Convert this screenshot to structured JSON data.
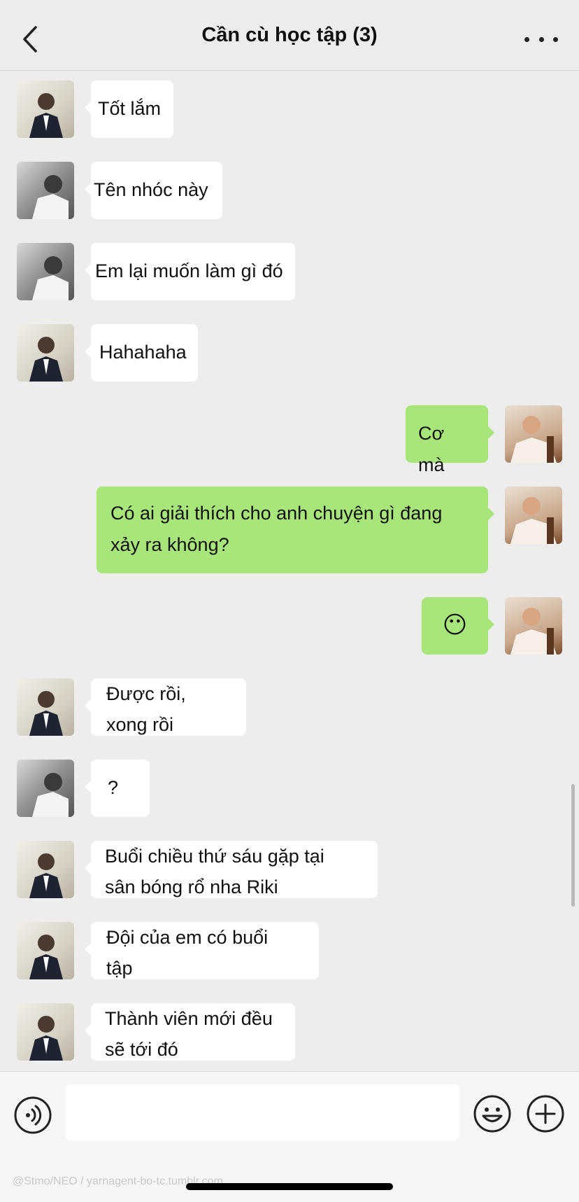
{
  "header": {
    "title": "Cần cù học tập (3)",
    "back_icon": "chevron-left-icon",
    "more_icon": "more-dots-icon"
  },
  "messages": [
    {
      "side": "in",
      "avatar": "suit",
      "text": "Tốt lắm"
    },
    {
      "side": "in",
      "avatar": "bw",
      "text": "Tên nhóc này"
    },
    {
      "side": "in",
      "avatar": "bw",
      "text": "Em lại muốn làm gì đó"
    },
    {
      "side": "in",
      "avatar": "suit",
      "text": "Hahahaha"
    },
    {
      "side": "out",
      "avatar": "pink",
      "text": "Cơ mà"
    },
    {
      "side": "out",
      "avatar": "pink",
      "text": "Có ai giải thích cho anh chuyện gì đang\nxảy ra không?"
    },
    {
      "side": "out",
      "avatar": "pink",
      "text": "😶"
    },
    {
      "side": "in",
      "avatar": "suit",
      "text": "Được rồi,\nxong rồi"
    },
    {
      "side": "in",
      "avatar": "bw",
      "text": "?"
    },
    {
      "side": "in",
      "avatar": "suit",
      "text": "Buổi chiều thứ sáu gặp tại\nsân bóng rổ nha Riki"
    },
    {
      "side": "in",
      "avatar": "suit",
      "text": "Đội của em có buổi\ntập"
    },
    {
      "side": "in",
      "avatar": "suit",
      "text": "Thành viên mới đều\nsẽ tới đó"
    }
  ],
  "input_bar": {
    "value": "",
    "voice_icon": "voice-icon",
    "emoji_icon": "emoji-icon",
    "plus_icon": "plus-icon",
    "watermark": "@Stmo/NEO / yarnagent-bo-tc.tumblr.com"
  }
}
